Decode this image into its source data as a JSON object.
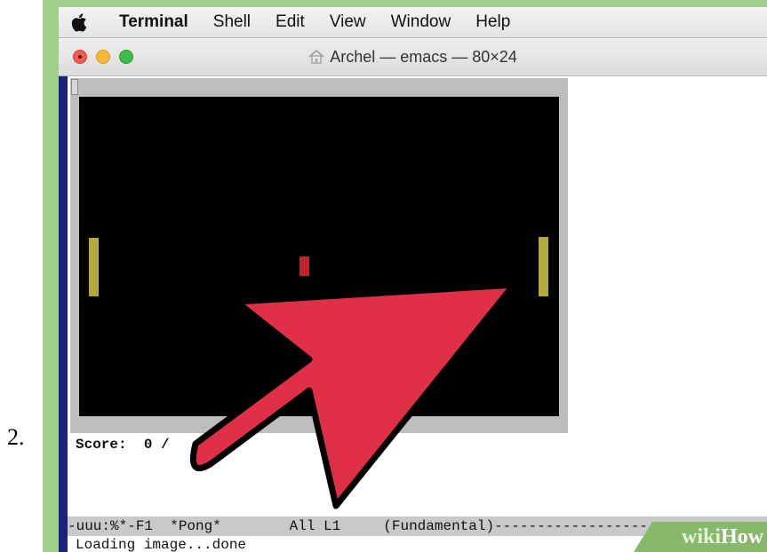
{
  "step": {
    "number": "2."
  },
  "menubar": {
    "apple_icon": "apple-logo-icon",
    "items": [
      "Terminal",
      "Shell",
      "Edit",
      "View",
      "Window",
      "Help"
    ]
  },
  "window": {
    "title": "Archel — emacs — 80×24",
    "title_icon": "home-folder-icon"
  },
  "game": {
    "name": "Pong",
    "colors": {
      "background": "#000000",
      "paddle": "#b5a93a",
      "ball": "#c0242b"
    },
    "score_text": "Score:  0 /"
  },
  "emacs": {
    "modeline": "-uuu:%*-F1  *Pong*        All L1     (Fundamental)---------------------------",
    "minibuffer": "Loading image...done"
  },
  "overlay": {
    "arrow_icon": "pointing-arrow-icon",
    "arrow_color": "#e03047"
  },
  "watermark": {
    "prefix": "wiki",
    "suffix": "How"
  }
}
